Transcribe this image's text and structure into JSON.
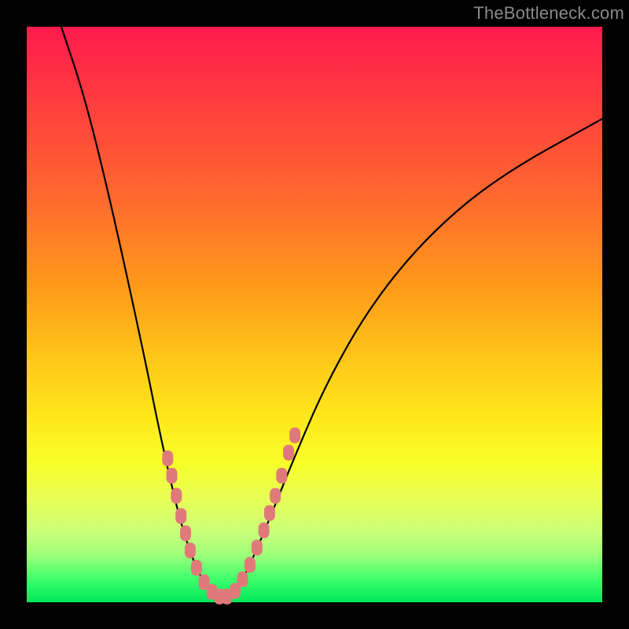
{
  "watermark": "TheBottleneck.com",
  "chart_data": {
    "type": "line",
    "title": "",
    "xlabel": "",
    "ylabel": "",
    "xlim": [
      0,
      100
    ],
    "ylim": [
      0,
      100
    ],
    "grid": false,
    "legend_position": "none",
    "curve_points": [
      {
        "x": 6,
        "y": 100
      },
      {
        "x": 10,
        "y": 88
      },
      {
        "x": 14,
        "y": 72
      },
      {
        "x": 18,
        "y": 54
      },
      {
        "x": 21,
        "y": 40
      },
      {
        "x": 23,
        "y": 30
      },
      {
        "x": 25,
        "y": 21
      },
      {
        "x": 27,
        "y": 13
      },
      {
        "x": 29,
        "y": 7
      },
      {
        "x": 31,
        "y": 3
      },
      {
        "x": 33,
        "y": 1
      },
      {
        "x": 35,
        "y": 1
      },
      {
        "x": 37,
        "y": 3
      },
      {
        "x": 39,
        "y": 7
      },
      {
        "x": 42,
        "y": 14
      },
      {
        "x": 46,
        "y": 24
      },
      {
        "x": 52,
        "y": 38
      },
      {
        "x": 60,
        "y": 52
      },
      {
        "x": 70,
        "y": 64
      },
      {
        "x": 82,
        "y": 74
      },
      {
        "x": 100,
        "y": 84
      }
    ],
    "markers": [
      {
        "x": 24.5,
        "y": 25
      },
      {
        "x": 25.2,
        "y": 22
      },
      {
        "x": 26.0,
        "y": 18.5
      },
      {
        "x": 26.8,
        "y": 15
      },
      {
        "x": 27.6,
        "y": 12
      },
      {
        "x": 28.4,
        "y": 9
      },
      {
        "x": 29.5,
        "y": 6
      },
      {
        "x": 30.8,
        "y": 3.5
      },
      {
        "x": 32.2,
        "y": 1.8
      },
      {
        "x": 33.5,
        "y": 1.0
      },
      {
        "x": 34.8,
        "y": 1.0
      },
      {
        "x": 36.2,
        "y": 2.0
      },
      {
        "x": 37.5,
        "y": 4.0
      },
      {
        "x": 38.8,
        "y": 6.5
      },
      {
        "x": 40.0,
        "y": 9.5
      },
      {
        "x": 41.2,
        "y": 12.5
      },
      {
        "x": 42.2,
        "y": 15.5
      },
      {
        "x": 43.2,
        "y": 18.5
      },
      {
        "x": 44.3,
        "y": 22
      },
      {
        "x": 45.5,
        "y": 26
      },
      {
        "x": 46.6,
        "y": 29
      }
    ],
    "background_gradient": {
      "top": "#ff1a4d",
      "mid": "#ffe81a",
      "bottom": "#00e65a"
    }
  }
}
